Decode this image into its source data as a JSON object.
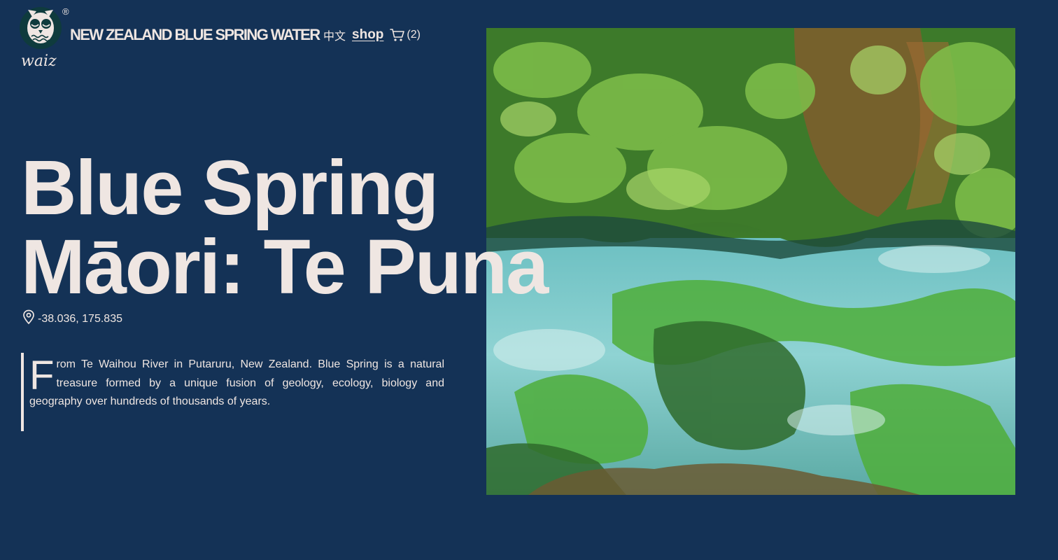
{
  "header": {
    "registered_mark": "®",
    "logo_text": "waiz",
    "brand": "NEW ZEALAND BLUE SPRING WATER",
    "lang": "中文",
    "shop": "shop",
    "cart_count": "(2)"
  },
  "hero": {
    "title_line1": "Blue Spring",
    "title_line2": "Māori: Te Puna",
    "coordinates": "-38.036, 175.835",
    "intro_first_letter": "F",
    "intro_rest": "rom Te Waihou River in Putaruru, New Zealand. Blue Spring is a natural treasure formed by a unique fusion of geology, ecology, biology and geography over hundreds of thousands of years."
  },
  "colors": {
    "background": "#143256",
    "text": "#efe6e2",
    "water": "#6fc4c7",
    "foliage": "#4f8a2e"
  },
  "icons": {
    "logo": "owl-logo-icon",
    "cart": "cart-icon",
    "location": "map-pin-icon"
  }
}
